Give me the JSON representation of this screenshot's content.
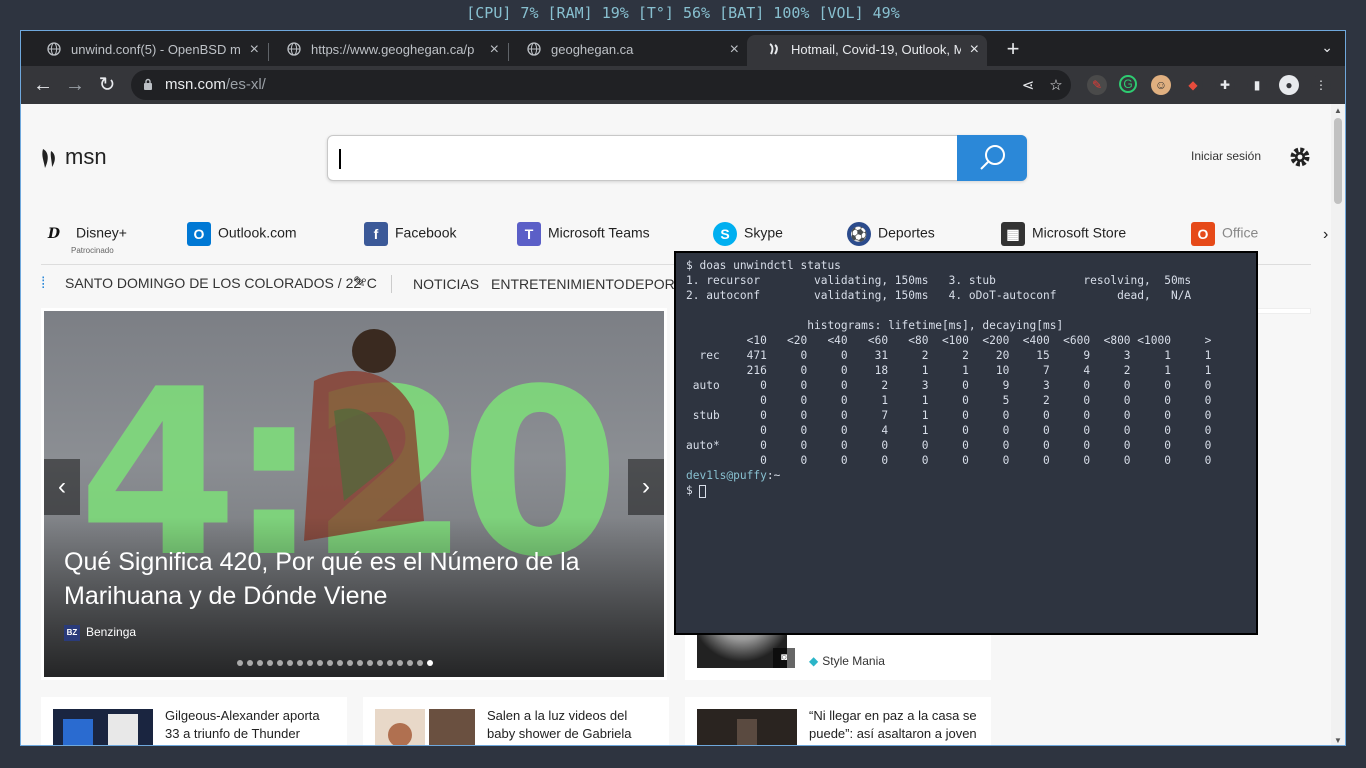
{
  "statusbar": {
    "text": "[CPU] 7% [RAM] 19% [T°] 56% [BAT] 100% [VOL] 49%"
  },
  "tabs": [
    {
      "label": "unwind.conf(5) - OpenBSD m",
      "icon": "globe-icon"
    },
    {
      "label": "https://www.geoghegan.ca/p",
      "icon": "globe-icon"
    },
    {
      "label": "geoghegan.ca",
      "icon": "globe-icon"
    },
    {
      "label": "Hotmail, Covid-19, Outlook, M",
      "icon": "msn-icon",
      "active": true
    }
  ],
  "omnibox": {
    "host": "msn.com",
    "path": "/es-xl/"
  },
  "msn": {
    "logo_text": "msn",
    "search_placeholder": "",
    "signin": "Iniciar sesión",
    "quicklinks": [
      {
        "label": "Disney+",
        "sub": "Patrocinado",
        "icon": "disney-icon"
      },
      {
        "label": "Outlook.com",
        "icon": "outlook-icon",
        "color": "#0078d4"
      },
      {
        "label": "Facebook",
        "icon": "facebook-icon",
        "color": "#3b5998"
      },
      {
        "label": "Microsoft Teams",
        "icon": "teams-icon",
        "color": "#5b5fc7"
      },
      {
        "label": "Skype",
        "icon": "skype-icon",
        "color": "#00aff0"
      },
      {
        "label": "Deportes",
        "icon": "deportes-icon",
        "color": "#2b4b8c"
      },
      {
        "label": "Microsoft Store",
        "icon": "store-icon",
        "color": "#333333"
      },
      {
        "label": "Office",
        "icon": "office-icon",
        "color": "#e64a19"
      }
    ],
    "weather": "SANTO DOMINGO DE LOS COLORADOS / 22°C",
    "categories": [
      "NOTICIAS",
      "ENTRETENIMIENTO",
      "DEPORTES"
    ],
    "hero": {
      "big_text": "4:20",
      "title": "Qué Significa 420, Por qué es el Número de la Marihuana y de Dónde Viene",
      "source": "Benzinga",
      "source_badge": "BZ",
      "dots": 20,
      "active_dot": 19
    },
    "side_card": {
      "source": "Style Mania"
    },
    "news": [
      {
        "text": "Gilgeous-Alexander aporta 33 a triunfo de Thunder"
      },
      {
        "text": "Salen a la luz videos del baby shower de Gabriela Sevilla,"
      },
      {
        "text": "“Ni llegar en paz a la casa se puede”: así asaltaron a joven"
      }
    ]
  },
  "terminal": {
    "lines": [
      "$ doas unwindctl status",
      "1. recursor        validating, 150ms   3. stub             resolving,  50ms",
      "2. autoconf        validating, 150ms   4. oDoT-autoconf         dead,   N/A",
      "",
      "                  histograms: lifetime[ms], decaying[ms]",
      "         <10   <20   <40   <60   <80  <100  <200  <400  <600  <800 <1000     >",
      "  rec    471     0     0    31     2     2    20    15     9     3     1     1",
      "         216     0     0    18     1     1    10     7     4     2     1     1",
      " auto      0     0     0     2     3     0     9     3     0     0     0     0",
      "           0     0     0     1     1     0     5     2     0     0     0     0",
      " stub      0     0     0     7     1     0     0     0     0     0     0     0",
      "           0     0     0     4     1     0     0     0     0     0     0     0",
      "auto*      0     0     0     0     0     0     0     0     0     0     0     0",
      "           0     0     0     0     0     0     0     0     0     0     0     0"
    ],
    "prompt_user": "dev1ls@puffy",
    "prompt_path": ":~",
    "prompt_symbol": "$ "
  }
}
